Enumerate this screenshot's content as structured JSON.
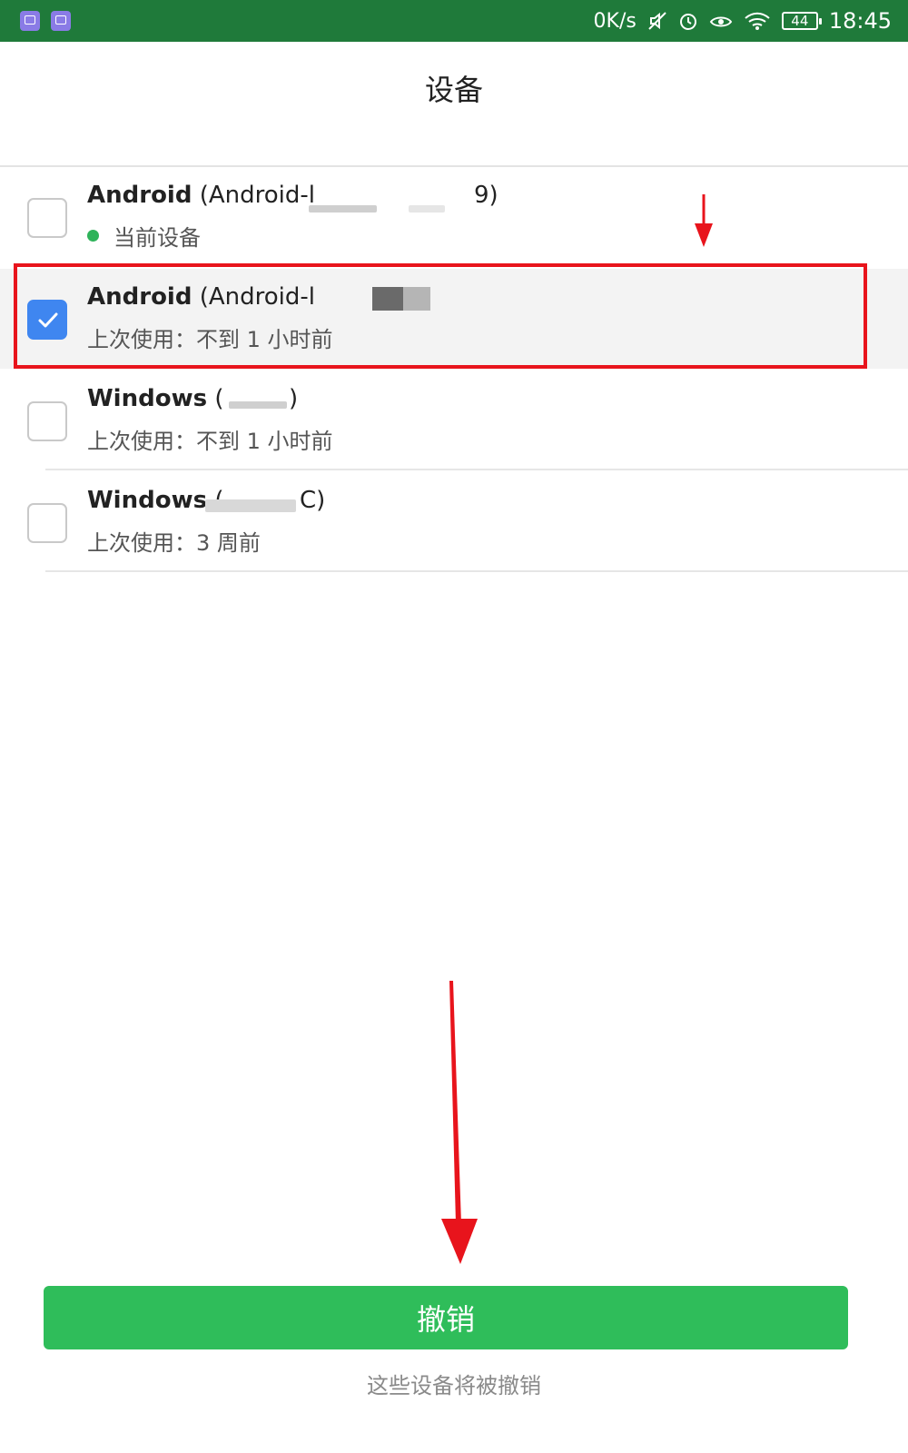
{
  "status_bar": {
    "net_speed": "0K/s",
    "battery": "44",
    "time": "18:45",
    "background_color": "#1f7a3a"
  },
  "header": {
    "title": "设备"
  },
  "devices": [
    {
      "type": "Android",
      "name": "(Android-l",
      "name_tail": "9)",
      "status": "当前设备",
      "selected": false,
      "current": true
    },
    {
      "type": "Android",
      "name": "(Android-l",
      "name_tail": "",
      "status": "上次使用：不到 1 小时前",
      "selected": true,
      "current": false
    },
    {
      "type": "Windows",
      "name": "(",
      "name_tail": ")",
      "status": "上次使用：不到 1 小时前",
      "selected": false,
      "current": false
    },
    {
      "type": "Windows",
      "name": "(",
      "name_tail": "C)",
      "status": "上次使用：3 周前",
      "selected": false,
      "current": false
    }
  ],
  "footer": {
    "revoke_label": "撤销",
    "hint": "这些设备将被撤销"
  },
  "colors": {
    "accent_green": "#2fbd5a",
    "checkbox_blue": "#3f86f0",
    "annotation_red": "#e8141c"
  }
}
